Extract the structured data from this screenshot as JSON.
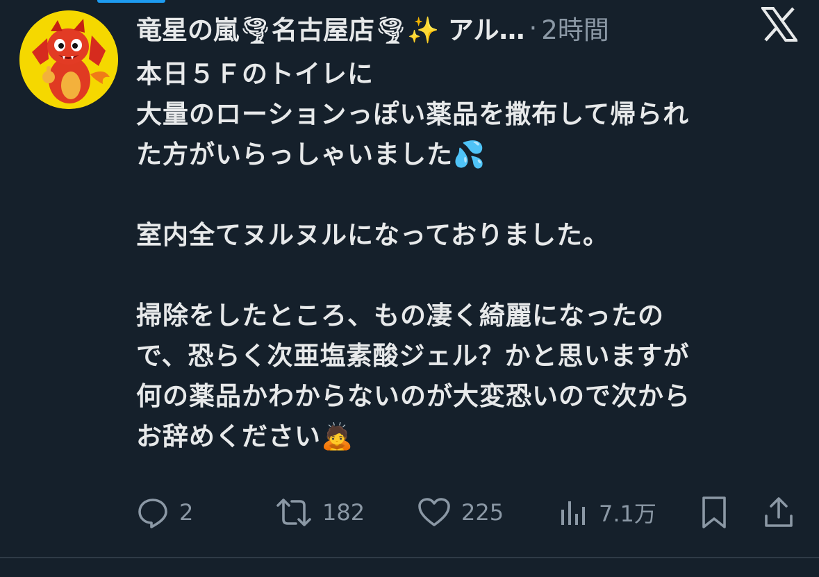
{
  "header": {
    "display_name": "竜星の嵐🌪名古屋店🌪✨ アル…",
    "separator": "·",
    "time": "2時間"
  },
  "body": {
    "lines": [
      "本日５Ｆのトイレに",
      "大量のローションっぽい薬品を撒布して帰られ",
      "た方がいらっしゃいました💦",
      "",
      "室内全てヌルヌルになっておりました。",
      "",
      "掃除をしたところ、もの凄く綺麗になったの",
      "で、恐らく次亜塩素酸ジェル？かと思いますが",
      "何の薬品かわからないのが大変恐いので次から",
      "お辞めください🙇"
    ]
  },
  "actions": {
    "reply_count": "2",
    "retweet_count": "182",
    "like_count": "225",
    "views_count": "7.1万"
  },
  "icons": {
    "reply": "reply-icon",
    "retweet": "retweet-icon",
    "like": "heart-icon",
    "views": "views-icon",
    "bookmark": "bookmark-icon",
    "share": "share-icon",
    "platform": "x-logo-icon"
  },
  "colors": {
    "background": "#15202b",
    "text": "#e7e9ea",
    "muted": "#8b98a5",
    "accent": "#1d9bf0"
  }
}
